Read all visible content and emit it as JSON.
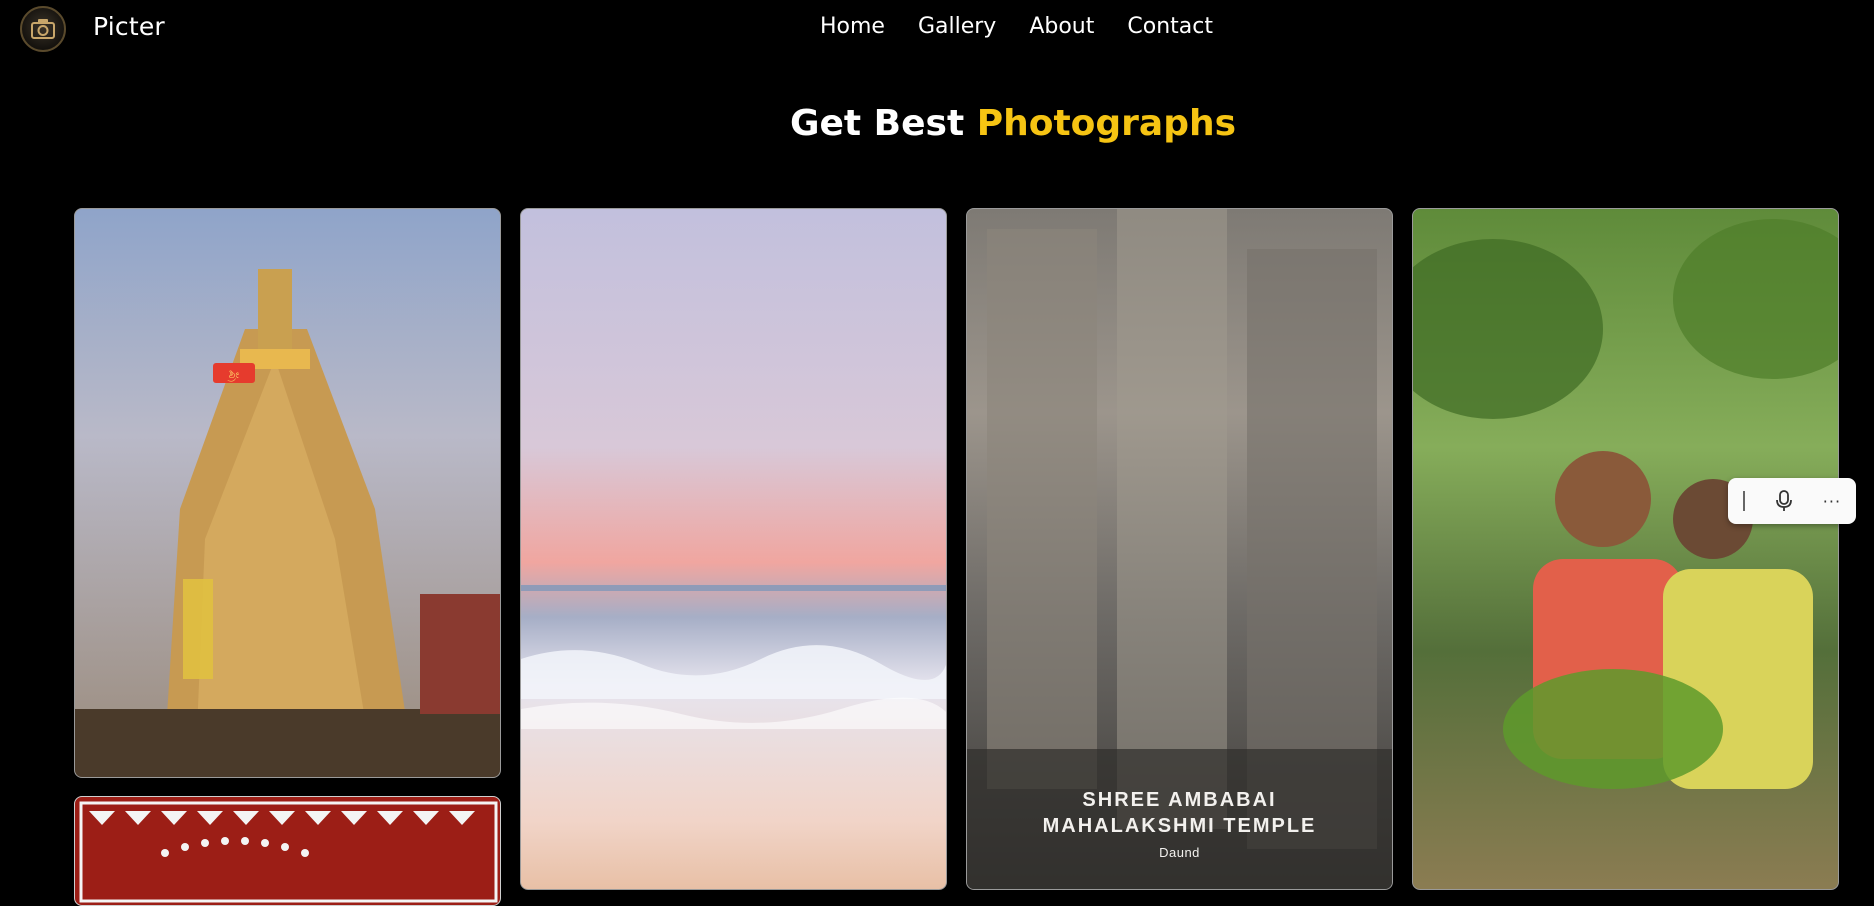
{
  "header": {
    "brand": "Picter",
    "nav": [
      "Home",
      "Gallery",
      "About",
      "Contact"
    ]
  },
  "hero": {
    "title_part1": "Get Best",
    "title_part2": "Photographs",
    "accent_color": "#f6c413"
  },
  "gallery": {
    "photos": [
      {
        "subject": "temple-tower-dusk",
        "sign": "ಶ್ರೀ"
      },
      {
        "subject": "beach-sunset"
      },
      {
        "subject": "stone-temple-carvings",
        "caption_line1": "SHREE AMBABAI",
        "caption_line2": "MAHALAKSHMI TEMPLE",
        "caption_location": "Daund"
      },
      {
        "subject": "two-boys-mango-tree"
      },
      {
        "subject": "warli-art-painting"
      }
    ]
  },
  "floating_toolbar": {
    "icons": [
      "grip-icon",
      "microphone-icon",
      "more-options-icon"
    ],
    "more_label": "···"
  }
}
